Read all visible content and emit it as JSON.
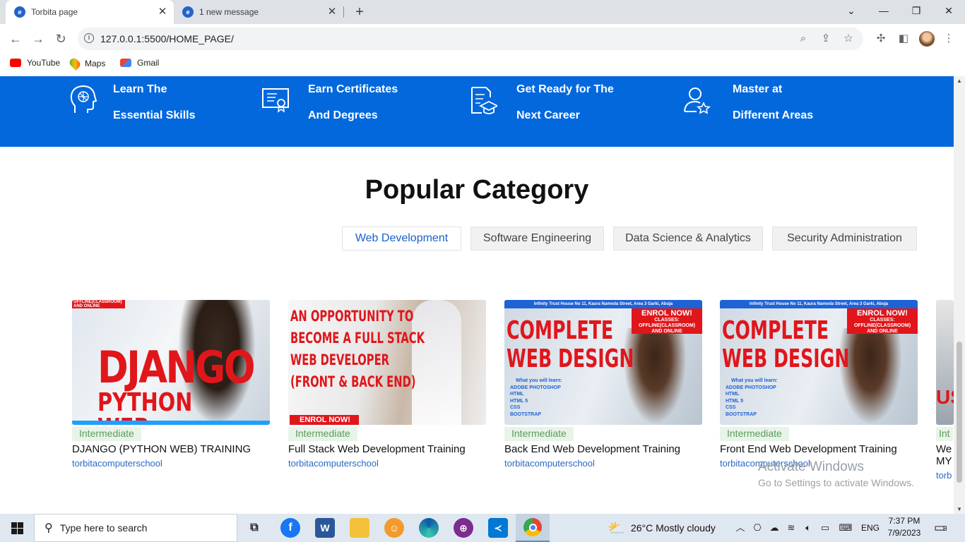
{
  "browser": {
    "tabs": [
      {
        "title": "Torbita page",
        "active": true
      },
      {
        "title": "1 new message",
        "active": false
      }
    ],
    "url": "127.0.0.1:5500/HOME_PAGE/",
    "bookmarks": [
      "YouTube",
      "Maps",
      "Gmail"
    ]
  },
  "banner": {
    "bg_color": "#0468dd",
    "features": [
      {
        "line1": "Learn The",
        "line2": "Essential Skills",
        "icon": "brain-head-icon"
      },
      {
        "line1": "Earn Certificates",
        "line2": "And Degrees",
        "icon": "certificate-icon"
      },
      {
        "line1": "Get Ready for The",
        "line2": "Next Career",
        "icon": "graduation-doc-icon"
      },
      {
        "line1": "Master at",
        "line2": "Different Areas",
        "icon": "user-star-icon"
      }
    ]
  },
  "popular": {
    "title": "Popular Category",
    "categories": [
      {
        "label": "Web Development",
        "active": true
      },
      {
        "label": "Software Engineering",
        "active": false
      },
      {
        "label": "Data Science & Analytics",
        "active": false
      },
      {
        "label": "Security Administration",
        "active": false
      }
    ]
  },
  "courses": [
    {
      "level": "Intermediate",
      "title": "DJANGO (PYTHON WEB) TRAINING",
      "author": "torbitacomputerschool",
      "thumb": {
        "top_strip": "OFFLINE(CLASSROOM) AND ONLINE",
        "headline1": "DJANGO",
        "headline2": "PYTHON WEB"
      }
    },
    {
      "level": "Intermediate",
      "title": "Full Stack Web Development Training",
      "author": "torbitacomputerschool",
      "thumb": {
        "lines": [
          "AN OPPORTUNITY TO",
          "BECOME A FULL STACK",
          "WEB DEVELOPER",
          "(FRONT & BACK END)"
        ],
        "cta": "ENROL NOW!"
      }
    },
    {
      "level": "Intermediate",
      "title": "Back End Web Development Training",
      "author": "torbitacomputerschool",
      "thumb": {
        "address": "Infinity Trust House No 11, Kaura Namoda Street, Area 3 Garki, Abuja",
        "enrol": "ENROL NOW!",
        "classes": "CLASSES: OFFLINE(CLASSROOM) AND ONLINE",
        "headline1": "COMPLETE",
        "headline2": "WEB DESIGN",
        "learn": "What you will learn:",
        "topics": [
          "ADOBE PHOTOSHOP",
          "HTML",
          "HTML 5",
          "CSS",
          "BOOTSTRAP"
        ]
      }
    },
    {
      "level": "Intermediate",
      "title": "Front End Web Development Training",
      "author": "torbitacomputerschool",
      "thumb": {
        "address": "Infinity Trust House No 11, Kaura Namoda Street, Area 3 Garki, Abuja",
        "enrol": "ENROL NOW!",
        "classes": "CLASSES: OFFLINE(CLASSROOM) AND ONLINE",
        "headline1": "COMPLETE",
        "headline2": "WEB DESIGN",
        "learn": "What you will learn:",
        "topics": [
          "ADOBE PHOTOSHOP",
          "HTML",
          "HTML 5",
          "CSS",
          "BOOTSTRAP"
        ]
      }
    },
    {
      "level": "Int",
      "title": "We",
      "title2": "MY",
      "author": "torb",
      "thumb": {
        "headline": "US"
      }
    }
  ],
  "watermark": {
    "line1": "Activate Windows",
    "line2": "Go to Settings to activate Windows."
  },
  "taskbar": {
    "search_placeholder": "Type here to search",
    "weather": "26°C  Mostly cloudy",
    "lang": "ENG",
    "time": "7:37 PM",
    "date": "7/9/2023",
    "notifications": "3"
  }
}
